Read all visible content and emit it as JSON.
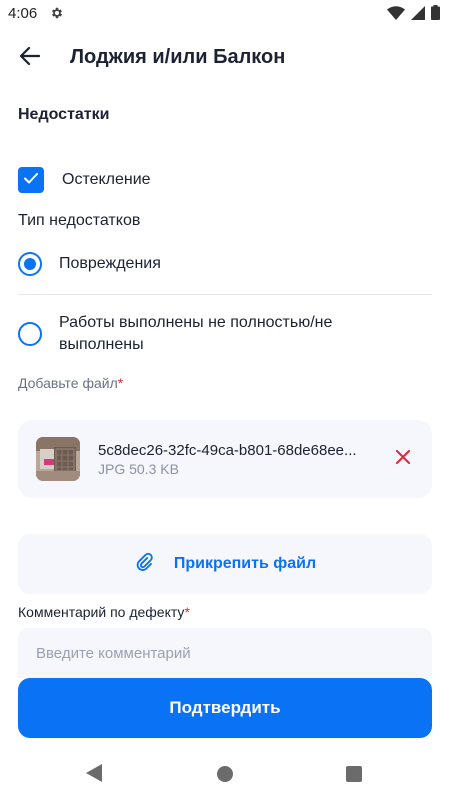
{
  "status_bar": {
    "time": "4:06"
  },
  "header": {
    "title": "Лоджия и/или Балкон"
  },
  "defects": {
    "section_title": "Недостатки",
    "checkbox_label": "Остекление",
    "checkbox_checked": true
  },
  "defect_type": {
    "title": "Тип недостатков",
    "options": [
      {
        "label": "Повреждения",
        "selected": true
      },
      {
        "label": "Работы выполнены не полностью/не выполнены",
        "selected": false
      }
    ]
  },
  "file_section": {
    "label": "Добавьте файл",
    "required_mark": "*",
    "file": {
      "name": "5c8dec26-32fc-49ca-b801-68de68ee...",
      "meta": "JPG 50.3 KB"
    },
    "attach_label": "Прикрепить файл"
  },
  "comment": {
    "label": "Комментарий по дефекту",
    "required_mark": "*",
    "placeholder": "Введите комментарий",
    "value": ""
  },
  "confirm_label": "Подтвердить",
  "colors": {
    "accent": "#0a72f5",
    "required": "#e0263e",
    "card_bg": "#f5f7fc"
  },
  "icons": [
    "gear-icon",
    "wifi-icon",
    "signal-icon",
    "battery-icon",
    "arrow-back-icon",
    "check-icon",
    "close-icon",
    "paperclip-icon",
    "nav-back-icon",
    "nav-home-icon",
    "nav-recent-icon"
  ]
}
